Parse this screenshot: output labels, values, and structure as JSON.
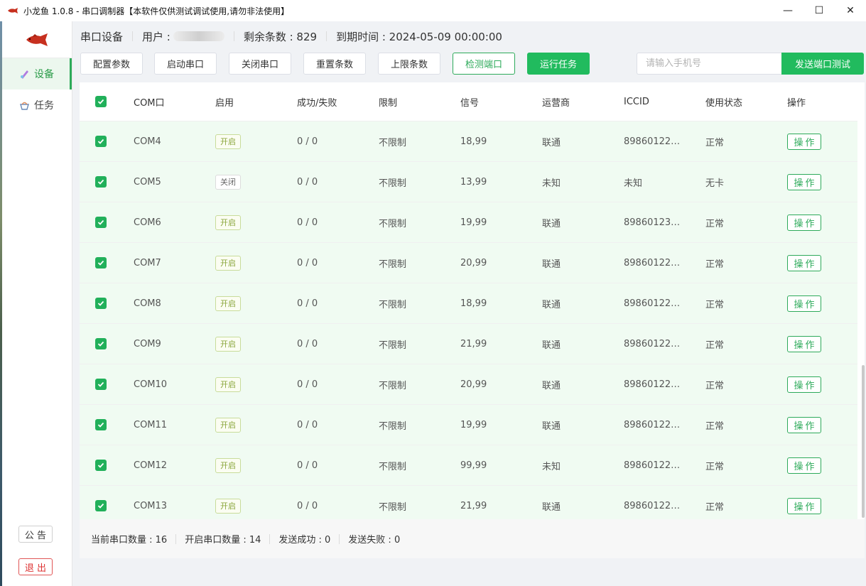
{
  "window": {
    "title": "小龙鱼 1.0.8 - 串口调制器【本软件仅供测试调试使用,请勿非法使用】",
    "minimize": "—",
    "maximize": "☐",
    "close": "✕"
  },
  "sidebar": {
    "items": [
      {
        "label": "设备",
        "icon": "device-icon",
        "active": true
      },
      {
        "label": "任务",
        "icon": "task-icon",
        "active": false
      }
    ],
    "notice_label": "公 告",
    "exit_label": "退 出"
  },
  "info": {
    "section": "串口设备",
    "user_label": "用户 : ",
    "remaining": "剩余条数 : 829",
    "expiry": "到期时间 : 2024-05-09 00:00:00"
  },
  "toolbar": {
    "buttons": [
      "配置参数",
      "启动串口",
      "关闭串口",
      "重置条数",
      "上限条数",
      "检测端口",
      "运行任务"
    ],
    "phone_placeholder": "请输入手机号",
    "send_label": "发送端口测试"
  },
  "table": {
    "headers": [
      "COM口",
      "启用",
      "成功/失败",
      "限制",
      "信号",
      "运营商",
      "ICCID",
      "使用状态",
      "操作"
    ],
    "rows": [
      {
        "port": "COM4",
        "enabled": "开启",
        "result": "0 / 0",
        "limit": "不限制",
        "signal": "18,99",
        "carrier": "联通",
        "iccid": "89860122…",
        "status": "正常",
        "op": "操作"
      },
      {
        "port": "COM5",
        "enabled": "关闭",
        "result": "0 / 0",
        "limit": "不限制",
        "signal": "13,99",
        "carrier": "未知",
        "iccid": "未知",
        "status": "无卡",
        "op": "操作"
      },
      {
        "port": "COM6",
        "enabled": "开启",
        "result": "0 / 0",
        "limit": "不限制",
        "signal": "19,99",
        "carrier": "联通",
        "iccid": "89860123…",
        "status": "正常",
        "op": "操作"
      },
      {
        "port": "COM7",
        "enabled": "开启",
        "result": "0 / 0",
        "limit": "不限制",
        "signal": "20,99",
        "carrier": "联通",
        "iccid": "89860122…",
        "status": "正常",
        "op": "操作"
      },
      {
        "port": "COM8",
        "enabled": "开启",
        "result": "0 / 0",
        "limit": "不限制",
        "signal": "18,99",
        "carrier": "联通",
        "iccid": "89860122…",
        "status": "正常",
        "op": "操作"
      },
      {
        "port": "COM9",
        "enabled": "开启",
        "result": "0 / 0",
        "limit": "不限制",
        "signal": "21,99",
        "carrier": "联通",
        "iccid": "89860122…",
        "status": "正常",
        "op": "操作"
      },
      {
        "port": "COM10",
        "enabled": "开启",
        "result": "0 / 0",
        "limit": "不限制",
        "signal": "20,99",
        "carrier": "联通",
        "iccid": "89860122…",
        "status": "正常",
        "op": "操作"
      },
      {
        "port": "COM11",
        "enabled": "开启",
        "result": "0 / 0",
        "limit": "不限制",
        "signal": "19,99",
        "carrier": "联通",
        "iccid": "89860122…",
        "status": "正常",
        "op": "操作"
      },
      {
        "port": "COM12",
        "enabled": "开启",
        "result": "0 / 0",
        "limit": "不限制",
        "signal": "99,99",
        "carrier": "未知",
        "iccid": "89860122…",
        "status": "正常",
        "op": "操作"
      },
      {
        "port": "COM13",
        "enabled": "开启",
        "result": "0 / 0",
        "limit": "不限制",
        "signal": "21,99",
        "carrier": "联通",
        "iccid": "89860122…",
        "status": "正常",
        "op": "操作"
      }
    ]
  },
  "footer": {
    "port_count": "当前串口数量 : 16",
    "open_count": "开启串口数量 : 14",
    "send_success": "发送成功 : 0",
    "send_fail": "发送失败 : 0"
  },
  "colors": {
    "accent": "#21bb5e",
    "row_bg": "#f0fbf2",
    "exit": "#d33333"
  }
}
